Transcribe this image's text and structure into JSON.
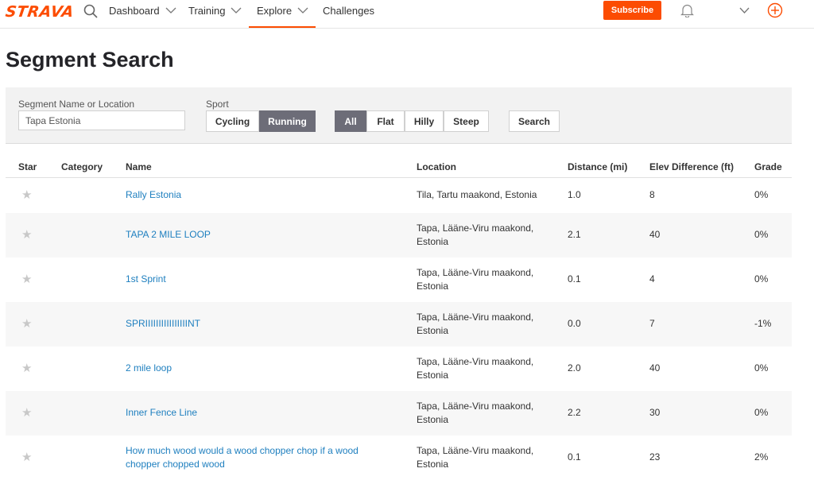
{
  "brand": {
    "name": "STRAVA",
    "accent": "#fc4c02",
    "link_color": "#1e7fbf"
  },
  "nav": {
    "dashboard": "Dashboard",
    "training": "Training",
    "explore": "Explore",
    "challenges": "Challenges",
    "subscribe": "Subscribe",
    "active_tab": "Explore"
  },
  "page": {
    "title": "Segment Search"
  },
  "filters": {
    "name_label": "Segment Name or Location",
    "name_value": "Tapa Estonia",
    "sport_label": "Sport",
    "sport_options": [
      "Cycling",
      "Running"
    ],
    "sport_selected": "Running",
    "terrain_options": [
      "All",
      "Flat",
      "Hilly",
      "Steep"
    ],
    "terrain_selected": "All",
    "search_button": "Search"
  },
  "table": {
    "columns": [
      "Star",
      "Category",
      "Name",
      "Location",
      "Distance (mi)",
      "Elev Difference (ft)",
      "Grade"
    ],
    "rows": [
      {
        "star": "★",
        "category": "",
        "name": "Rally Estonia",
        "location": "Tila, Tartu maakond, Estonia",
        "distance": "1.0",
        "elev": "8",
        "grade": "0%"
      },
      {
        "star": "★",
        "category": "",
        "name": "TAPA 2 MILE LOOP",
        "location": "Tapa, Lääne-Viru maakond, Estonia",
        "distance": "2.1",
        "elev": "40",
        "grade": "0%"
      },
      {
        "star": "★",
        "category": "",
        "name": "1st Sprint",
        "location": "Tapa, Lääne-Viru maakond, Estonia",
        "distance": "0.1",
        "elev": "4",
        "grade": "0%"
      },
      {
        "star": "★",
        "category": "",
        "name": "SPRIIIIIIIIIIIIIIIINT",
        "location": "Tapa, Lääne-Viru maakond, Estonia",
        "distance": "0.0",
        "elev": "7",
        "grade": "-1%"
      },
      {
        "star": "★",
        "category": "",
        "name": "2 mile loop",
        "location": "Tapa, Lääne-Viru maakond, Estonia",
        "distance": "2.0",
        "elev": "40",
        "grade": "0%"
      },
      {
        "star": "★",
        "category": "",
        "name": "Inner Fence Line",
        "location": "Tapa, Lääne-Viru maakond, Estonia",
        "distance": "2.2",
        "elev": "30",
        "grade": "0%"
      },
      {
        "star": "★",
        "category": "",
        "name": "How much wood would a wood chopper chop if a wood chopper chopped wood",
        "location": "Tapa, Lääne-Viru maakond, Estonia",
        "distance": "0.1",
        "elev": "23",
        "grade": "2%"
      }
    ]
  }
}
